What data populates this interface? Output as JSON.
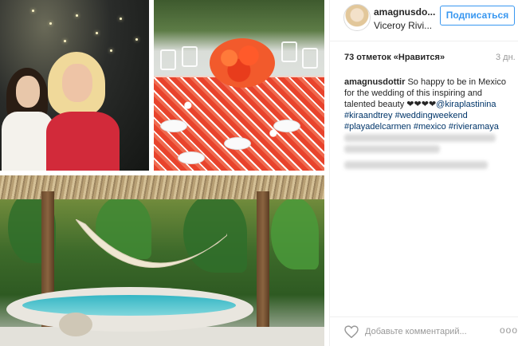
{
  "post": {
    "username": "amagnusdo...",
    "location": "Viceroy Rivi...",
    "follow_label": "Подписаться",
    "likes": "73 отметок «Нравится»",
    "time": "3 дн.",
    "caption": {
      "author": "amagnusdottir",
      "text": " So happy to be in Mexico for the wedding of this inspiring and talented beauty ",
      "hearts": "❤❤❤❤",
      "mention": "@kiraplastinina",
      "tags": [
        "#kiraandtrey",
        "#weddingweekend",
        "#playadelcarmen",
        "#mexico",
        "#rivieramaya"
      ]
    },
    "comment_placeholder": "Добавьте комментарий...",
    "more_label": "ooo"
  },
  "colors": {
    "accent": "#3897f0",
    "hashtag": "#003569",
    "muted": "#999999"
  },
  "icons": {
    "like": "heart-icon",
    "more": "more-options-icon"
  }
}
